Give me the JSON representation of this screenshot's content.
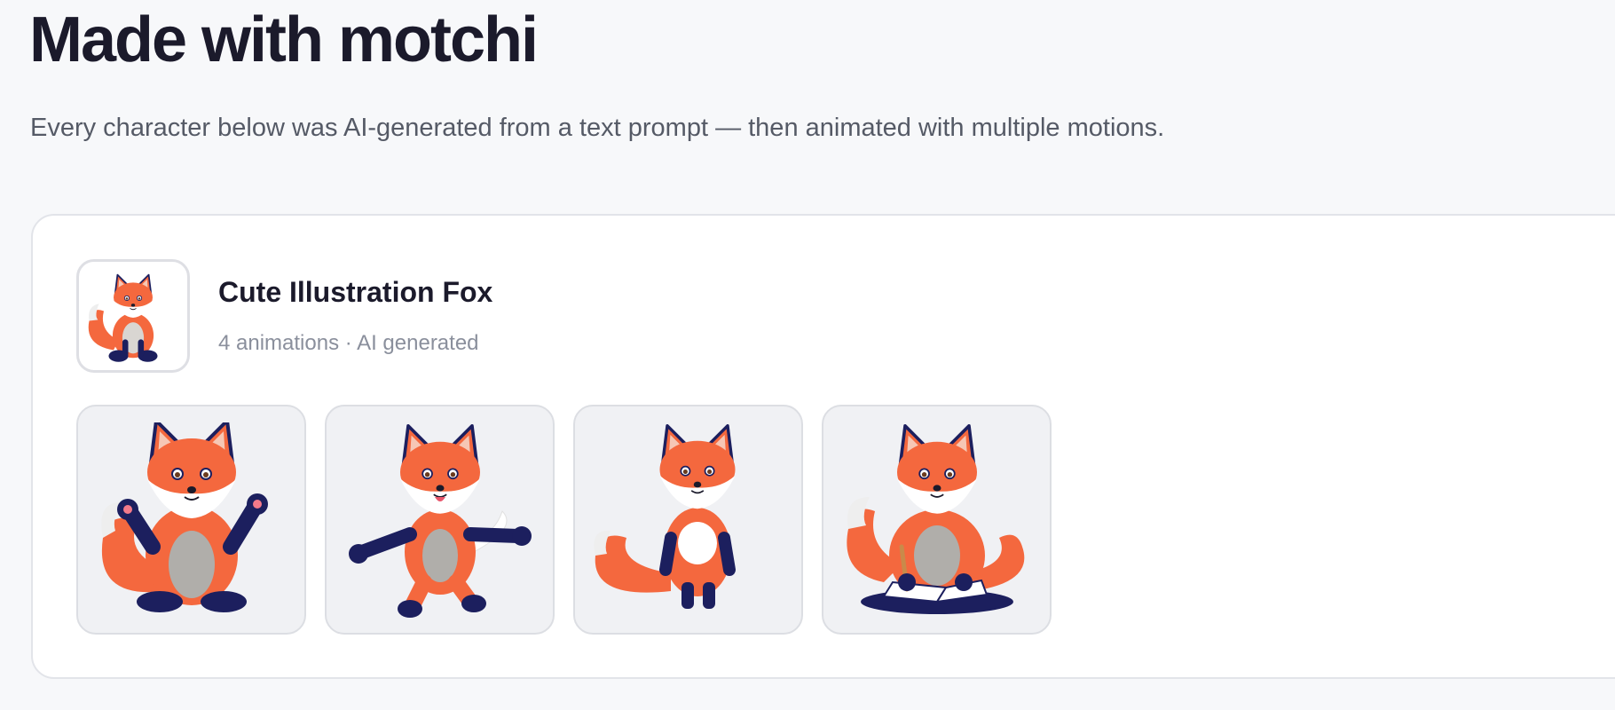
{
  "header": {
    "title": "Made with motchi",
    "subtitle": "Every character below was AI-generated from a text prompt — then animated with multiple motions."
  },
  "character": {
    "name": "Cute Illustration Fox",
    "meta": "4 animations · AI generated",
    "avatar_icon": "fox-sitting-icon",
    "animations": [
      {
        "icon": "fox-waving-icon"
      },
      {
        "icon": "fox-dancing-icon"
      },
      {
        "icon": "fox-standing-icon"
      },
      {
        "icon": "fox-writing-icon"
      }
    ]
  },
  "colors": {
    "background": "#f7f8fa",
    "card": "#ffffff",
    "thumb": "#f0f1f4",
    "fox_orange": "#f4683e",
    "fox_navy": "#1c1f5e",
    "fox_white": "#ffffff"
  }
}
